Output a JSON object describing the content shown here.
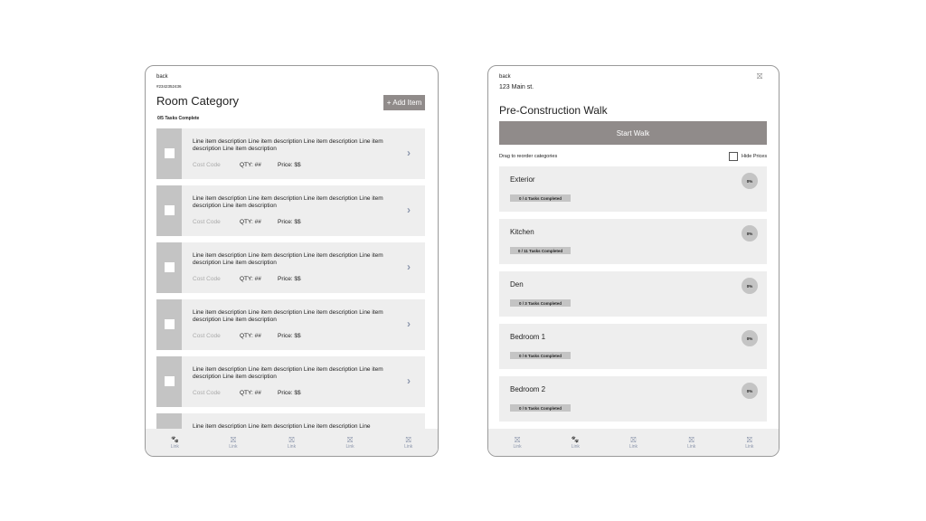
{
  "left": {
    "back": "back",
    "id": "#2342352436",
    "title": "Room Category",
    "add_item": "+ Add Item",
    "tasks": "0/5 Tasks Complete",
    "items": [
      {
        "desc": "Line item description Line item description Line item description Line item description Line item description",
        "cost_code": "Cost Code",
        "qty": "QTY: ##",
        "price": "Price: $$"
      },
      {
        "desc": "Line item description Line item description Line item description Line item description Line item description",
        "cost_code": "Cost Code",
        "qty": "QTY: ##",
        "price": "Price: $$"
      },
      {
        "desc": "Line item description Line item description Line item description Line item description Line item description",
        "cost_code": "Cost Code",
        "qty": "QTY: ##",
        "price": "Price: $$"
      },
      {
        "desc": "Line item description Line item description Line item description Line item description Line item description",
        "cost_code": "Cost Code",
        "qty": "QTY: ##",
        "price": "Price: $$"
      },
      {
        "desc": "Line item description Line item description Line item description Line item description Line item description",
        "cost_code": "Cost Code",
        "qty": "QTY: ##",
        "price": "Price: $$"
      },
      {
        "desc": "Line item description Line item description Line item description Line",
        "cost_code": "",
        "qty": "",
        "price": ""
      }
    ],
    "nav": [
      {
        "label": "Link",
        "icon": "paw-icon",
        "active": true
      },
      {
        "label": "Link",
        "icon": "gift-icon"
      },
      {
        "label": "Link",
        "icon": "gift-icon"
      },
      {
        "label": "Link",
        "icon": "gift-icon"
      },
      {
        "label": "Link",
        "icon": "gift-icon"
      }
    ]
  },
  "right": {
    "back": "back",
    "address": "123 Main st.",
    "title": "Pre-Construction Walk",
    "start": "Start Walk",
    "drag": "Drag to reorder categories",
    "hide_prices": "Hide Prices",
    "cards": [
      {
        "name": "Exterior",
        "tasks": "0 / 4 Tasks Completed",
        "pct": "0%"
      },
      {
        "name": "Kitchen",
        "tasks": "0 / 11 Tasks Completed",
        "pct": "0%"
      },
      {
        "name": "Den",
        "tasks": "0 / 3 Tasks Completed",
        "pct": "0%"
      },
      {
        "name": "Bedroom 1",
        "tasks": "0 / 6 Tasks Completed",
        "pct": "0%"
      },
      {
        "name": "Bedroom 2",
        "tasks": "0 / 5 Tasks Completed",
        "pct": "0%"
      }
    ],
    "nav": [
      {
        "label": "Link",
        "icon": "gift-icon"
      },
      {
        "label": "Link",
        "icon": "paw-icon",
        "active": true
      },
      {
        "label": "Link",
        "icon": "gift-icon"
      },
      {
        "label": "Link",
        "icon": "gift-icon"
      },
      {
        "label": "Link",
        "icon": "gift-icon"
      }
    ]
  },
  "colors": {
    "button": "#908b8a",
    "card": "#eeeeee",
    "thumb": "#c4c4c4",
    "icon": "#8c96ac"
  }
}
